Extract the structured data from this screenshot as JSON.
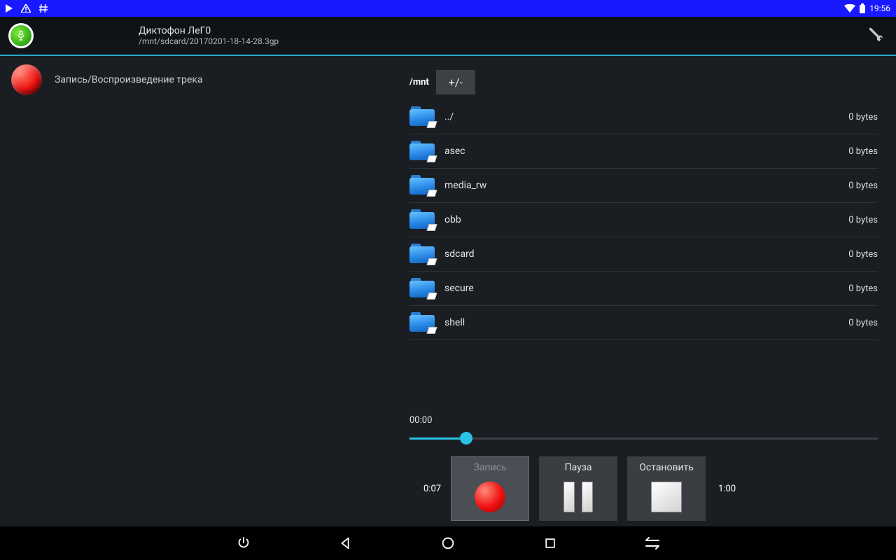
{
  "status": {
    "time": "19:56"
  },
  "header": {
    "muted_text": "",
    "title": "Диктофон ЛеГ0",
    "subtitle": "/mnt/sdcard/20170201-18-14-28.3gp"
  },
  "left": {
    "record_label": "Запись/Воспроизведение трека"
  },
  "browser": {
    "path": "/mnt",
    "toggle": "+/-",
    "items": [
      {
        "name": "../",
        "size": "0 bytes"
      },
      {
        "name": "asec",
        "size": "0 bytes"
      },
      {
        "name": "media_rw",
        "size": "0 bytes"
      },
      {
        "name": "obb",
        "size": "0 bytes"
      },
      {
        "name": "sdcard",
        "size": "0 bytes"
      },
      {
        "name": "secure",
        "size": "0 bytes"
      },
      {
        "name": "shell",
        "size": "0 bytes"
      }
    ]
  },
  "player": {
    "current": "00:00",
    "elapsed": "0:07",
    "total": "1:00",
    "buttons": {
      "record": "Запись",
      "pause": "Пауза",
      "stop": "Остановить"
    }
  }
}
